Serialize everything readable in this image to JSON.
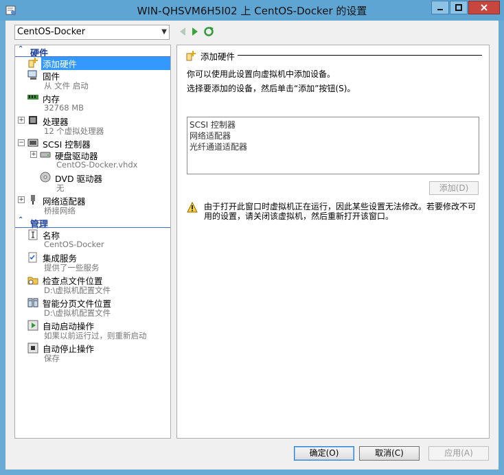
{
  "window": {
    "title": "WIN-QHSVM6H5I02 上 CentOS-Docker 的设置"
  },
  "vm_selector": {
    "value": "CentOS-Docker"
  },
  "tree": {
    "hardware_section": "硬件",
    "management_section": "管理",
    "hardware_items": [
      {
        "name": "添加硬件",
        "sub": ""
      },
      {
        "name": "固件",
        "sub": "从 文件 启动"
      },
      {
        "name": "内存",
        "sub": "32768 MB"
      },
      {
        "name": "处理器",
        "sub": "12 个虚拟处理器"
      },
      {
        "name": "SCSI 控制器",
        "sub": ""
      },
      {
        "name": "硬盘驱动器",
        "sub": "CentOS-Docker.vhdx"
      },
      {
        "name": "DVD 驱动器",
        "sub": "无"
      },
      {
        "name": "网络适配器",
        "sub": "桥接网络"
      }
    ],
    "management_items": [
      {
        "name": "名称",
        "sub": "CentOS-Docker"
      },
      {
        "name": "集成服务",
        "sub": "提供了一些服务"
      },
      {
        "name": "检查点文件位置",
        "sub": "D:\\虚拟机配置文件"
      },
      {
        "name": "智能分页文件位置",
        "sub": "D:\\虚拟机配置文件"
      },
      {
        "name": "自动启动操作",
        "sub": "如果以前运行过，则重新启动"
      },
      {
        "name": "自动停止操作",
        "sub": "保存"
      }
    ]
  },
  "panel": {
    "heading": "添加硬件",
    "desc1": "你可以使用此设置向虚拟机中添加设备。",
    "desc2": "选择要添加的设备，然后单击“添加”按钮(S)。",
    "devices": [
      "SCSI 控制器",
      "网络适配器",
      "光纤通道适配器"
    ],
    "add_label": "添加(D)",
    "warning": "由于打开此窗口时虚拟机正在运行，因此某些设置无法修改。若要修改不可用的设置，请关闭该虚拟机，然后重新打开该窗口。"
  },
  "buttons": {
    "ok": "确定(O)",
    "cancel": "取消(C)",
    "apply": "应用(A)"
  },
  "colors": {
    "selection": "#3399ff",
    "section_text": "#1a3e9e",
    "titlebar": "#5fa5d3"
  }
}
